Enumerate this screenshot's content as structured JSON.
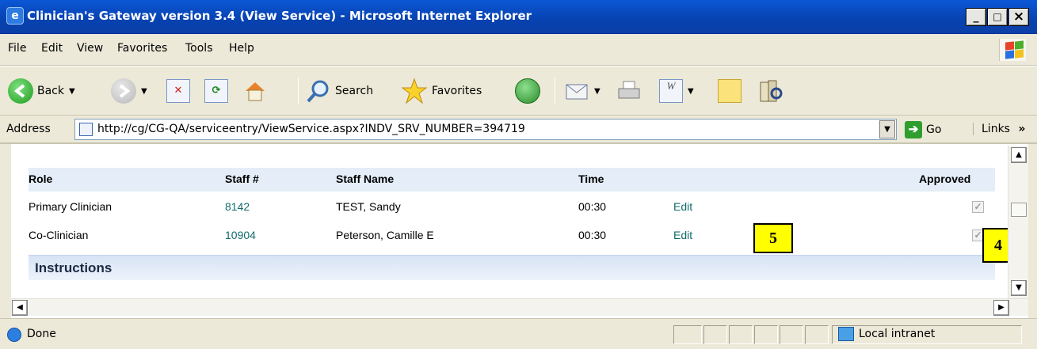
{
  "window": {
    "title": "Clinician's Gateway version 3.4 (View Service) - Microsoft Internet Explorer",
    "minimize": "_",
    "maximize": "□",
    "close": "×"
  },
  "menu": [
    "File",
    "Edit",
    "View",
    "Favorites",
    "Tools",
    "Help"
  ],
  "toolbar": {
    "back_label": "Back",
    "search_label": "Search",
    "favorites_label": "Favorites",
    "icons": [
      "back-icon",
      "forward-icon",
      "stop-icon",
      "refresh-icon",
      "home-icon",
      "search-icon",
      "favorites-star-icon",
      "history-icon",
      "mail-icon",
      "print-icon",
      "edit-word-icon",
      "discuss-icon",
      "messenger-icon"
    ]
  },
  "address": {
    "label": "Address",
    "url": "http://cg/CG-QA/serviceentry/ViewService.aspx?INDV_SRV_NUMBER=394719",
    "go_label": "Go",
    "links_label": "Links",
    "links_chevron": "»"
  },
  "table": {
    "headers": {
      "role": "Role",
      "staff_num": "Staff #",
      "staff_name": "Staff Name",
      "time": "Time",
      "approved": "Approved"
    },
    "rows": [
      {
        "role": "Primary Clinician",
        "staff_num": "8142",
        "staff_name": "TEST, Sandy",
        "time": "00:30",
        "edit": "Edit",
        "approved": true
      },
      {
        "role": "Co-Clinician",
        "staff_num": "10904",
        "staff_name": "Peterson, Camille E",
        "time": "00:30",
        "edit": "Edit",
        "approved": true
      }
    ]
  },
  "instructions_heading": "Instructions",
  "callouts": {
    "five": "5",
    "four": "4"
  },
  "status": {
    "text": "Done",
    "zone": "Local intranet"
  },
  "colors": {
    "title_bar": "#0a57d6",
    "chrome": "#ece9d8",
    "link": "#126b6b",
    "header_row": "#e4edf8",
    "callout": "#ffff00"
  }
}
